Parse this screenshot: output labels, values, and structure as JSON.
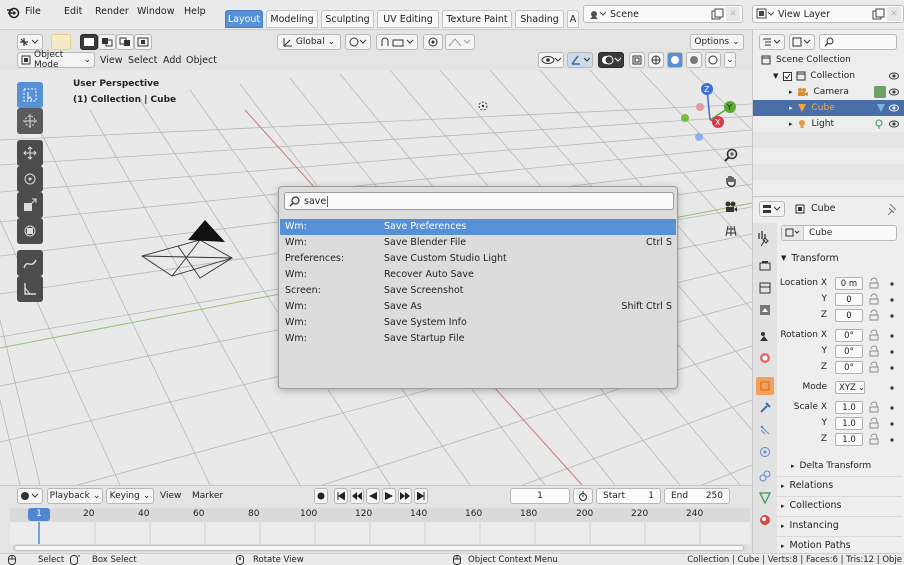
{
  "topbar": {
    "menus": [
      "File",
      "Edit",
      "Render",
      "Window",
      "Help"
    ],
    "workspaces": [
      "Layout",
      "Modeling",
      "Sculpting",
      "UV Editing",
      "Texture Paint",
      "Shading",
      "A"
    ],
    "scene": "Scene",
    "view_layer": "View Layer"
  },
  "vp_header": {
    "mode": "Object Mode",
    "menus": [
      "View",
      "Select",
      "Add",
      "Object"
    ],
    "orientation": "Global",
    "options": "Options"
  },
  "viewport": {
    "perspective": "User Perspective",
    "collection_label": "(1) Collection | Cube"
  },
  "search": {
    "query": "save",
    "results": [
      {
        "category": "Wm:",
        "name": "Save Preferences",
        "shortcut": ""
      },
      {
        "category": "Wm:",
        "name": "Save Blender File",
        "shortcut": "Ctrl S"
      },
      {
        "category": "Preferences:",
        "name": "Save Custom Studio Light",
        "shortcut": ""
      },
      {
        "category": "Wm:",
        "name": "Recover Auto Save",
        "shortcut": ""
      },
      {
        "category": "Screen:",
        "name": "Save Screenshot",
        "shortcut": ""
      },
      {
        "category": "Wm:",
        "name": "Save As",
        "shortcut": "Shift Ctrl S"
      },
      {
        "category": "Wm:",
        "name": "Save System Info",
        "shortcut": ""
      },
      {
        "category": "Wm:",
        "name": "Save Startup File",
        "shortcut": ""
      }
    ]
  },
  "timeline": {
    "playback": "Playback",
    "keying": "Keying",
    "view": "View",
    "marker": "Marker",
    "current_frame": "1",
    "start_label": "Start",
    "start": "1",
    "end_label": "End",
    "end": "250",
    "ruler": [
      "1",
      "20",
      "40",
      "60",
      "80",
      "100",
      "120",
      "140",
      "160",
      "180",
      "200",
      "220",
      "240"
    ]
  },
  "outliner": {
    "root": "Scene Collection",
    "collection": "Collection",
    "items": [
      "Camera",
      "Cube",
      "Light"
    ]
  },
  "properties": {
    "object_name": "Cube",
    "data_name": "Cube",
    "transform_header": "Transform",
    "location_label": "Location X",
    "location": [
      "0 m",
      "0",
      "0"
    ],
    "rotation_label": "Rotation X",
    "rotation": [
      "0°",
      "0°",
      "0°"
    ],
    "mode_label": "Mode",
    "mode": "XYZ",
    "scale_label": "Scale X",
    "scale": [
      "1.0",
      "1.0",
      "1.0"
    ],
    "y_label": "Y",
    "z_label": "Z",
    "delta": "Delta Transform",
    "sections": [
      "Relations",
      "Collections",
      "Instancing",
      "Motion Paths"
    ]
  },
  "status": {
    "select": "Select",
    "box_select": "Box Select",
    "rotate_view": "Rotate View",
    "context_menu": "Object Context Menu",
    "stats": "Collection | Cube | Verts:8 | Faces:6 | Tris:12 | Obje"
  }
}
